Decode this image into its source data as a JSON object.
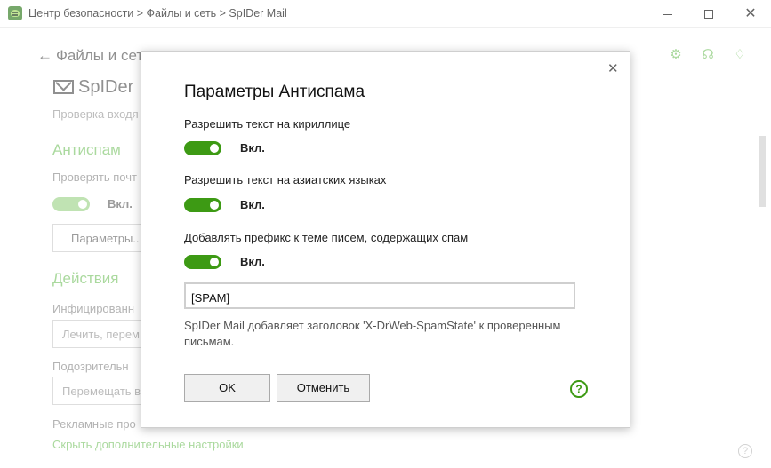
{
  "window": {
    "title": "Центр безопасности > Файлы и сеть > SpIDer Mail",
    "minimize": "—",
    "maximize": "☐",
    "close": "✕"
  },
  "background": {
    "back_label": "Файлы и сет",
    "page_title": "SpIDer",
    "subtitle": "Проверка входя",
    "section_antispam": "Антиспам",
    "check_label": "Проверять почт",
    "toggle_state": "Вкл.",
    "params_button": "Параметры..",
    "section_actions": "Действия",
    "infected_label": "Инфицированн",
    "infected_value": "Лечить, перем",
    "suspicious_label": "Подозрительн",
    "suspicious_value": "Перемещать в",
    "ads_label": "Рекламные про",
    "hide_link": "Скрыть дополнительные настройки",
    "help": "?"
  },
  "icons": {
    "gear": "⚙",
    "headset": "☊",
    "bell": "♢"
  },
  "dialog": {
    "title": "Параметры Антиспама",
    "close": "✕",
    "options": [
      {
        "label": "Разрешить текст на кириллице",
        "state": "Вкл.",
        "enabled": true
      },
      {
        "label": "Разрешить текст на азиатских языках",
        "state": "Вкл.",
        "enabled": true
      },
      {
        "label": "Добавлять префикс к теме писем, содержащих спам",
        "state": "Вкл.",
        "enabled": true
      }
    ],
    "prefix_value": "[SPAM]",
    "hint": "SpIDer Mail добавляет заголовок 'X-DrWeb-SpamState' к проверенным письмам.",
    "ok_label": "OK",
    "cancel_label": "Отменить",
    "help": "?"
  },
  "colors": {
    "accent": "#3d9a14",
    "section_green": "#7dc56a"
  }
}
